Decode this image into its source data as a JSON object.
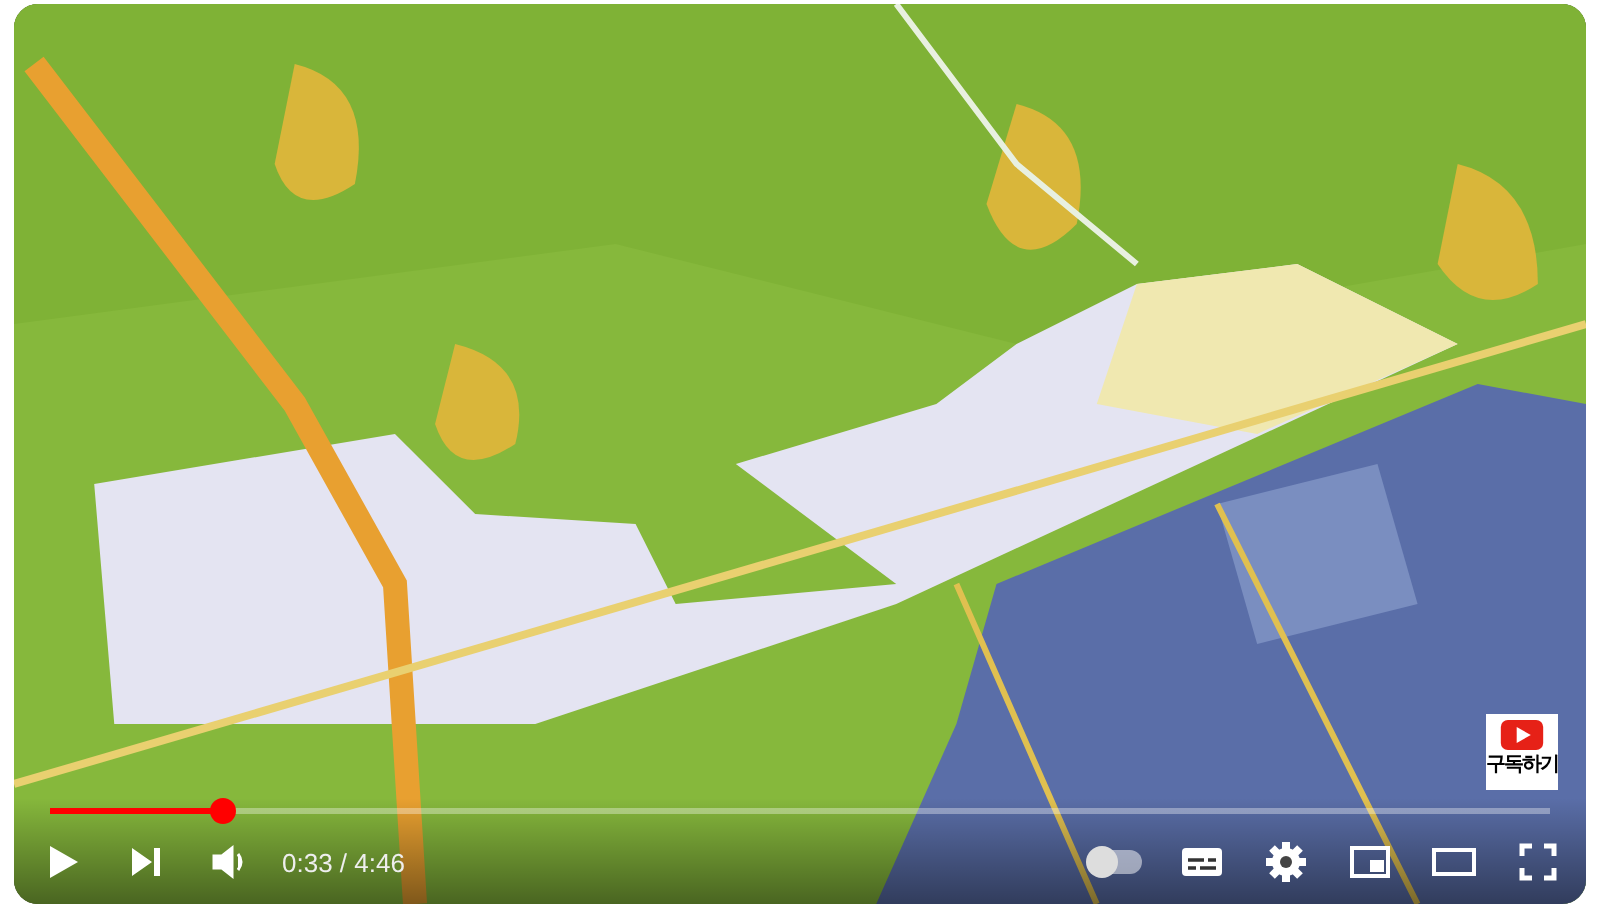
{
  "player": {
    "watermark": {
      "label": "구독하기"
    },
    "progress": {
      "level": 0.115
    },
    "autoplay": {
      "on": false
    },
    "time": "0:33 / 4:46"
  }
}
